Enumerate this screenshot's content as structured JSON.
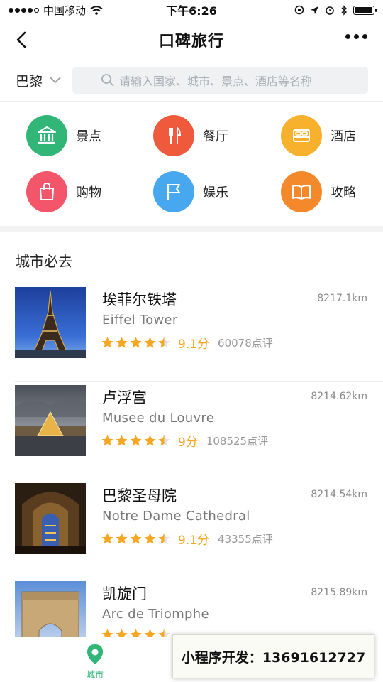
{
  "status_bar": {
    "carrier": "中国移动",
    "time": "下午6:26",
    "battery_level": 0.95
  },
  "nav": {
    "title": "口碑旅行"
  },
  "search": {
    "city": "巴黎",
    "placeholder": "请输入国家、城市、景点、酒店等名称"
  },
  "categories": [
    {
      "label": "景点",
      "color": "#31b678",
      "icon": "museum-icon"
    },
    {
      "label": "餐厅",
      "color": "#f05a3c",
      "icon": "fork-knife-icon"
    },
    {
      "label": "酒店",
      "color": "#f8b12c",
      "icon": "bed-icon"
    },
    {
      "label": "购物",
      "color": "#f3566b",
      "icon": "shopping-bag-icon"
    },
    {
      "label": "娱乐",
      "color": "#47a8ef",
      "icon": "flag-icon"
    },
    {
      "label": "攻略",
      "color": "#f4892b",
      "icon": "book-icon"
    }
  ],
  "section": {
    "title": "城市必去"
  },
  "places": [
    {
      "name": "埃菲尔铁塔",
      "en": "Eiffel Tower",
      "distance": "8217.1km",
      "rating": 4.5,
      "score": "9.1分",
      "reviews": "60078点评"
    },
    {
      "name": "卢浮宫",
      "en": "Musee du Louvre",
      "distance": "8214.62km",
      "rating": 4.5,
      "score": "9分",
      "reviews": "108525点评"
    },
    {
      "name": "巴黎圣母院",
      "en": "Notre Dame Cathedral",
      "distance": "8214.54km",
      "rating": 4.5,
      "score": "9.1分",
      "reviews": "43355点评"
    },
    {
      "name": "凯旋门",
      "en": "Arc de Triomphe",
      "distance": "8215.89km",
      "rating": 4.5,
      "score": "",
      "reviews": ""
    }
  ],
  "tab_bar": {
    "city_label": "城市"
  },
  "watermark": "小程序开发：13691612727",
  "colors": {
    "accent": "#31b678",
    "star": "#f5a623"
  }
}
